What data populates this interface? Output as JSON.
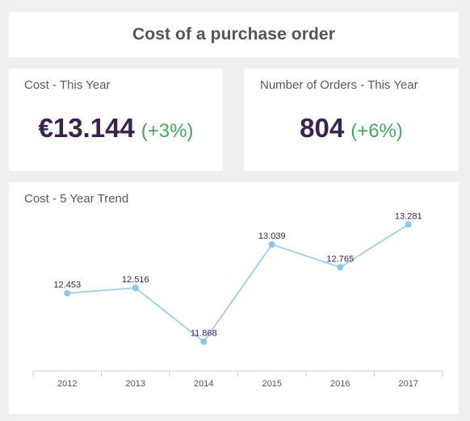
{
  "header": {
    "title": "Cost of a purchase order"
  },
  "kpis": {
    "cost": {
      "label": "Cost - This Year",
      "value": "€13.144",
      "change": "(+3%)"
    },
    "orders": {
      "label": "Number of Orders - This Year",
      "value": "804",
      "change": "(+6%)"
    }
  },
  "trend": {
    "label": "Cost - 5 Year Trend"
  },
  "colors": {
    "line": "#9fcff0",
    "point": "#8cc5ee",
    "value_text": "#3b2250",
    "positive_change": "#4aa85c",
    "axis": "#cfcfcf"
  },
  "chart_data": {
    "type": "line",
    "title": "Cost - 5 Year Trend",
    "categories": [
      "2012",
      "2013",
      "2014",
      "2015",
      "2016",
      "2017"
    ],
    "values": [
      12453,
      12516,
      11868,
      13039,
      12765,
      13281
    ],
    "labels": [
      "12.453",
      "12.516",
      "11.868",
      "13.039",
      "12.765",
      "13.281"
    ],
    "grid": false,
    "legend": "none"
  }
}
